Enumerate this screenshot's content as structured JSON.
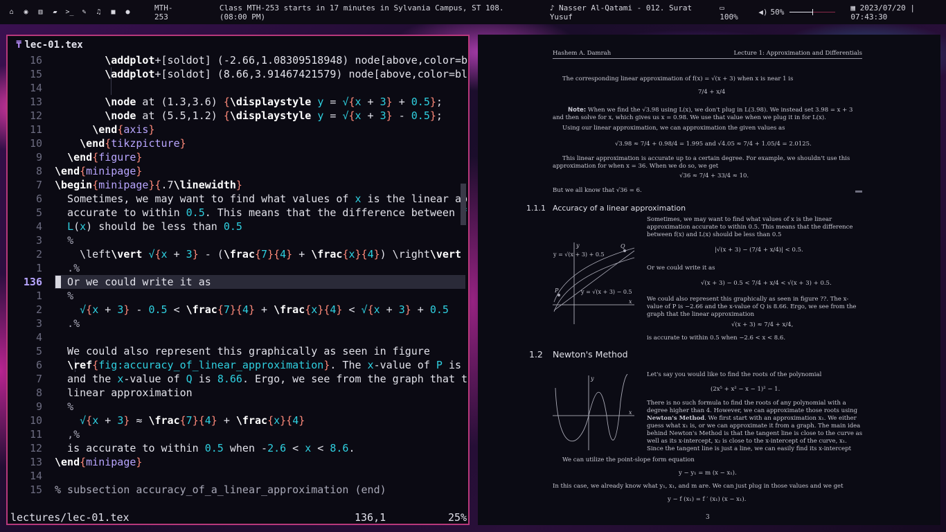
{
  "topbar": {
    "icons": [
      "home-icon",
      "globe-icon",
      "bank-icon",
      "folder-icon",
      "terminal-icon",
      "edit-icon",
      "music-icon",
      "video-icon",
      "chat-icon"
    ],
    "workspace": "MTH-253",
    "notice": "Class MTH-253 starts in 17 minutes in Sylvania Campus, ST 108. (08:00 PM)",
    "music": "♪ Nasser Al-Qatami - 012. Surat Yusuf",
    "battery": "100%",
    "volume": "50%",
    "volume_level": 0.5,
    "datetime": "2023/07/20 | 07:43:30"
  },
  "editor": {
    "title": "lec-01.tex",
    "status_file": "lectures/lec-01.tex",
    "status_pos": "136,1",
    "status_pct": "25%"
  },
  "pdf": {
    "header_left": "Hashem A. Damrah",
    "header_right": "Lecture 1: Approximation and Differentials",
    "p1": "The corresponding linear approximation of f(x) = √(x + 3) when x is near 1 is",
    "eq1": "7/4 + x/4",
    "note_label": "Note:",
    "note": "When we find the √3.98 using L(x), we don't plug in L(3.98). We instead set 3.98 = x + 3 and then solve for x, which gives us x = 0.98. We use that value when we plug it in for L(x).",
    "p2": "Using our linear approximation, we can approximation the given values as",
    "eq2": "√3.98 ≈ 7/4 + 0.98/4 = 1.995      and      √4.05 ≈ 7/4 + 1.05/4 = 2.0125.",
    "p3": "This linear approximation is accurate up to a certain degree. For example, we shouldn't use this approximation for when x = 36. When we do so, we get",
    "eq3": "√36 ≈ 7/4 + 33/4 ≈ 10.",
    "p4": "But we all know that √36 = 6.",
    "sec_num": "1.1.1",
    "sec_title": "Accuracy of a linear approximation",
    "p5": "Sometimes, we may want to find what values of x is the linear approximation accurate to within 0.5. This means that the difference between f(x) and L(x) should be less than 0.5",
    "eq4": "|√(x + 3) − (7/4 + x/4)| < 0.5.",
    "p6": "Or we could write it as",
    "eq5": "√(x + 3) − 0.5 < 7/4 + x/4 < √(x + 3) + 0.5.",
    "p7": "We could also represent this graphically as seen in figure ??. The x-value of P is −2.66 and the x-value of Q is 8.66. Ergo, we see from the graph that the linear approximation",
    "eq6": "√(x + 3) ≈ 7/4 + x/4,",
    "p8": "is accurate to within 0.5 when −2.6 < x < 8.6.",
    "fig1_top": "y = √(x + 3) + 0.5",
    "fig1_bot": "y = √(x + 3) − 0.5",
    "fig1_y": "y",
    "fig1_x": "x",
    "fig1_P": "P",
    "fig1_Q": "Q",
    "sec2_num": "1.2",
    "sec2_title": "Newton's Method",
    "p9": "Let's say you would like to find the roots of the polynomial",
    "eq7": "(2x⁵ + x² − x − 1)² − 1.",
    "p10a": "There is no such formula to find the roots of any polynomial with a degree higher than 4. However, we can approximate those roots using ",
    "p10b": "Newton's Method",
    "p10c": ". We first start with an approximation x₁. We either guess what x₁ is, or we can approximate it from a graph. The main idea behind Newton's Method is that the tangent line is close to the curve as well as its x-intercept, x₂ is close to the x-intercept of the curve, x₁. Since the tangent line is just a line, we can easily find its x-intercept",
    "p11": "We can utilize the point-slope form equation",
    "eq8": "y − y₁ = m (x − x₁).",
    "p12": "In this case, we already know what y₁, x₁, and m are. We can just plug in those values and we get",
    "eq9": "y − f (x₁) = f ′ (x₁) (x − x₁).",
    "page": "3"
  }
}
